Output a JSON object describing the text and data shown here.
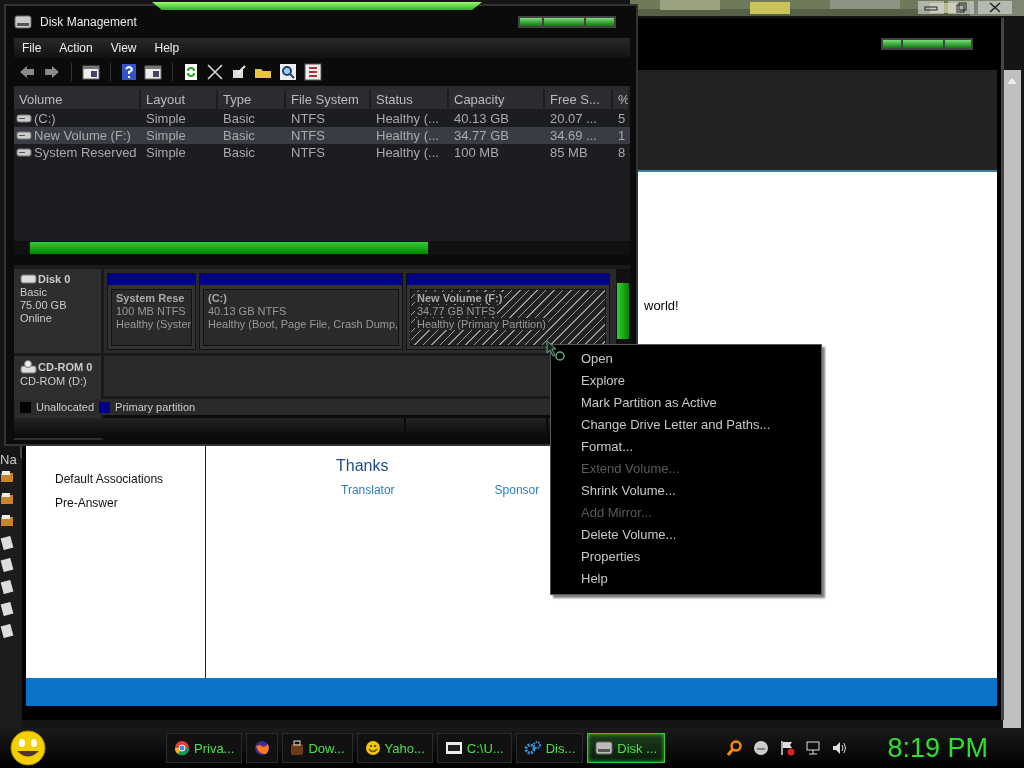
{
  "desktop": {
    "side_label": "Na"
  },
  "background_window": {
    "text": "world!",
    "heading": "Thanks",
    "links": [
      "Translator",
      "Sponsor"
    ],
    "sidebar": [
      {
        "label": "Default Associations"
      },
      {
        "label": "Pre-Answer"
      }
    ]
  },
  "disk_management": {
    "title": "Disk Management",
    "menu": [
      "File",
      "Action",
      "View",
      "Help"
    ],
    "columns": [
      "Volume",
      "Layout",
      "Type",
      "File System",
      "Status",
      "Capacity",
      "Free S...",
      "%"
    ],
    "rows": [
      {
        "cells": [
          "(C:)",
          "Simple",
          "Basic",
          "NTFS",
          "Healthy (...",
          "40.13 GB",
          "20.07 ...",
          "5"
        ],
        "selected": false
      },
      {
        "cells": [
          "New Volume (F:)",
          "Simple",
          "Basic",
          "NTFS",
          "Healthy (...",
          "34.77 GB",
          "34.69 ...",
          "1"
        ],
        "selected": true
      },
      {
        "cells": [
          "System Reserved",
          "Simple",
          "Basic",
          "NTFS",
          "Healthy (...",
          "100 MB",
          "85 MB",
          "8"
        ],
        "selected": false
      }
    ],
    "disks": [
      {
        "kind": "disk",
        "name": "Disk 0",
        "details": [
          "Basic",
          "75.00 GB",
          "Online"
        ],
        "partitions": [
          {
            "title": "System Rese",
            "size": "100 MB NTFS",
            "status": "Healthy (Syster",
            "selected": false
          },
          {
            "title": "(C:)",
            "size": "40.13 GB NTFS",
            "status": "Healthy (Boot, Page File, Crash Dump,",
            "selected": false
          },
          {
            "title": "New Volume  (F:)",
            "size": "34.77 GB NTFS",
            "status": "Healthy (Primary Partition)",
            "selected": true
          }
        ]
      },
      {
        "kind": "cdrom",
        "name": "CD-ROM 0",
        "details": [
          "CD-ROM (D:)"
        ]
      }
    ],
    "legend": [
      {
        "label": "Unallocated",
        "color": "#000000"
      },
      {
        "label": "Primary partition",
        "color": "#00008b"
      }
    ]
  },
  "context_menu": [
    {
      "label": "Open",
      "disabled": false
    },
    {
      "label": "Explore",
      "disabled": false
    },
    {
      "label": "Mark Partition as Active",
      "disabled": false
    },
    {
      "label": "Change Drive Letter and Paths...",
      "disabled": false
    },
    {
      "label": "Format...",
      "disabled": false
    },
    {
      "label": "Extend Volume...",
      "disabled": true
    },
    {
      "label": "Shrink Volume...",
      "disabled": false
    },
    {
      "label": "Add Mirror...",
      "disabled": true
    },
    {
      "label": "Delete Volume...",
      "disabled": false
    },
    {
      "label": "Properties",
      "disabled": false
    },
    {
      "label": "Help",
      "disabled": false
    }
  ],
  "taskbar": {
    "buttons": [
      {
        "kind": "browser",
        "label": "Priva...",
        "selected": false
      },
      {
        "kind": "fox",
        "selected": false
      },
      {
        "kind": "download",
        "label": "Dow...",
        "selected": false
      },
      {
        "kind": "chat",
        "label": "Yaho...",
        "selected": false
      },
      {
        "kind": "console",
        "label": "C:\\U...",
        "selected": false
      },
      {
        "kind": "settings",
        "label": "Dis...",
        "selected": false
      },
      {
        "kind": "disk",
        "label": "Disk ...",
        "selected": true
      }
    ],
    "clock": "8:19 PM"
  }
}
